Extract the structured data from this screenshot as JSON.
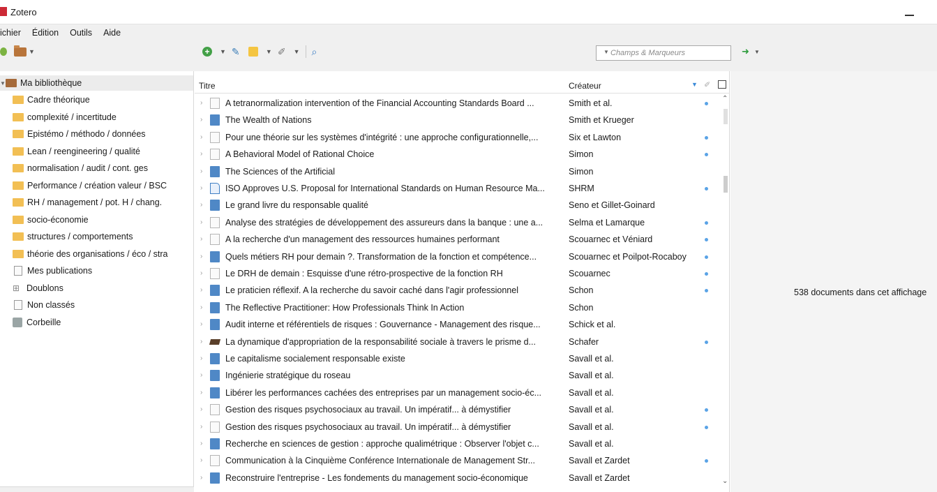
{
  "window": {
    "title": "Zotero"
  },
  "menubar": {
    "items": [
      "ichier",
      "Édition",
      "Outils",
      "Aide"
    ]
  },
  "search": {
    "mode_placeholder": "Champs & Marqueurs"
  },
  "library": {
    "root": "Ma bibliothèque",
    "collections": [
      "Cadre théorique",
      "complexité / incertitude",
      "Epistémo / méthodo / données",
      "Lean / reengineering / qualité",
      "normalisation / audit / cont. ges",
      "Performance / création valeur / BSC",
      "RH / management / pot. H / chang.",
      "socio-économie",
      "structures / comportements",
      "théorie des organisations / éco / stra"
    ],
    "special": [
      "Mes publications",
      "Doublons",
      "Non classés",
      "Corbeille"
    ]
  },
  "columns": {
    "title": "Titre",
    "creator": "Créateur"
  },
  "items": [
    {
      "title": "A tetranormalization intervention of the Financial Accounting Standards Board ...",
      "creator": "Smith et al.",
      "type": "journal",
      "attach": true
    },
    {
      "title": "The Wealth of Nations",
      "creator": "Smith et Krueger",
      "type": "book",
      "attach": false
    },
    {
      "title": "Pour une théorie sur les systèmes d'intégrité : une approche configurationnelle,...",
      "creator": "Six et Lawton",
      "type": "journal",
      "attach": true
    },
    {
      "title": "A Behavioral Model of Rational Choice",
      "creator": "Simon",
      "type": "journal",
      "attach": true
    },
    {
      "title": "The Sciences of the Artificial",
      "creator": "Simon",
      "type": "book",
      "attach": false
    },
    {
      "title": "ISO Approves U.S. Proposal for International Standards on Human Resource Ma...",
      "creator": "SHRM",
      "type": "report",
      "attach": true
    },
    {
      "title": "Le grand livre du responsable qualité",
      "creator": "Seno et Gillet-Goinard",
      "type": "book",
      "attach": false
    },
    {
      "title": "Analyse des stratégies de développement des assureurs dans la banque : une a...",
      "creator": "Selma et Lamarque",
      "type": "journal",
      "attach": true
    },
    {
      "title": "A la recherche d'un management des ressources humaines performant",
      "creator": "Scouarnec et Véniard",
      "type": "journal",
      "attach": true
    },
    {
      "title": "Quels métiers RH pour demain ?. Transformation de la fonction et compétence...",
      "creator": "Scouarnec et Poilpot-Rocaboy",
      "type": "book",
      "attach": true
    },
    {
      "title": "Le DRH de demain : Esquisse d'une rétro-prospective de la fonction RH",
      "creator": "Scouarnec",
      "type": "journal",
      "attach": true
    },
    {
      "title": "Le praticien réflexif. A la recherche du savoir caché dans l'agir professionnel",
      "creator": "Schon",
      "type": "book",
      "attach": true
    },
    {
      "title": "The Reflective Practitioner: How Professionals Think In Action",
      "creator": "Schon",
      "type": "book",
      "attach": false
    },
    {
      "title": "Audit interne et référentiels de risques : Gouvernance - Management des risque...",
      "creator": "Schick et al.",
      "type": "book",
      "attach": false
    },
    {
      "title": "La dynamique d'appropriation de la responsabilité sociale à travers le prisme d...",
      "creator": "Schafer",
      "type": "thesis",
      "attach": true
    },
    {
      "title": "Le capitalisme socialement responsable existe",
      "creator": "Savall et al.",
      "type": "book",
      "attach": false
    },
    {
      "title": "Ingénierie stratégique du roseau",
      "creator": "Savall et al.",
      "type": "book",
      "attach": false
    },
    {
      "title": "Libérer les performances cachées des entreprises par un management socio-éc...",
      "creator": "Savall et al.",
      "type": "book",
      "attach": false
    },
    {
      "title": "Gestion des risques psychosociaux au travail. Un impératif... à démystifier",
      "creator": "Savall et al.",
      "type": "journal",
      "attach": true
    },
    {
      "title": "Gestion des risques psychosociaux au travail. Un impératif... à démystifier",
      "creator": "Savall et al.",
      "type": "journal",
      "attach": true
    },
    {
      "title": "Recherche en sciences de gestion : approche qualimétrique : Observer l'objet c...",
      "creator": "Savall et al.",
      "type": "book",
      "attach": false
    },
    {
      "title": "Communication à la Cinquième Conférence Internationale de Management Str...",
      "creator": "Savall et Zardet",
      "type": "journal",
      "attach": true
    },
    {
      "title": "Reconstruire l'entreprise - Les fondements du management socio-économique",
      "creator": "Savall et Zardet",
      "type": "book",
      "attach": false
    }
  ],
  "status": {
    "message": "538 documents dans cet affichage"
  },
  "colors": {
    "accent": "#5aa3e6",
    "folder": "#f2bf54",
    "library_folder": "#a56a3a",
    "zotero_red": "#cc2936"
  }
}
